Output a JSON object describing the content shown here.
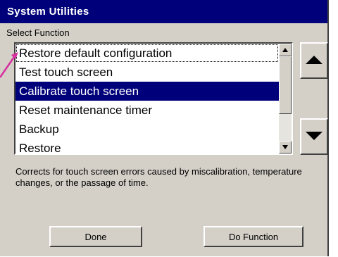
{
  "window": {
    "title": "System Utilities"
  },
  "function_section": {
    "label": "Select Function"
  },
  "functions": [
    {
      "label": "Restore default configuration",
      "state": "focused"
    },
    {
      "label": "Test touch screen",
      "state": "normal"
    },
    {
      "label": "Calibrate touch screen",
      "state": "selected"
    },
    {
      "label": "Reset maintenance timer",
      "state": "normal"
    },
    {
      "label": "Backup",
      "state": "normal"
    },
    {
      "label": "Restore",
      "state": "normal"
    }
  ],
  "description": "Corrects for touch screen errors caused by miscalibration, temperature changes, or the passage of time.",
  "buttons": {
    "done": "Done",
    "do_function": "Do Function"
  },
  "colors": {
    "selection": "#00007b",
    "title_bar": "#00007b",
    "dialog": "#d4d0c8",
    "callout": "#d62ea0"
  },
  "icons": {
    "scroll_up": "triangle-up-icon",
    "scroll_down": "triangle-down-icon",
    "page_up": "triangle-up-icon",
    "page_down": "triangle-down-icon"
  }
}
